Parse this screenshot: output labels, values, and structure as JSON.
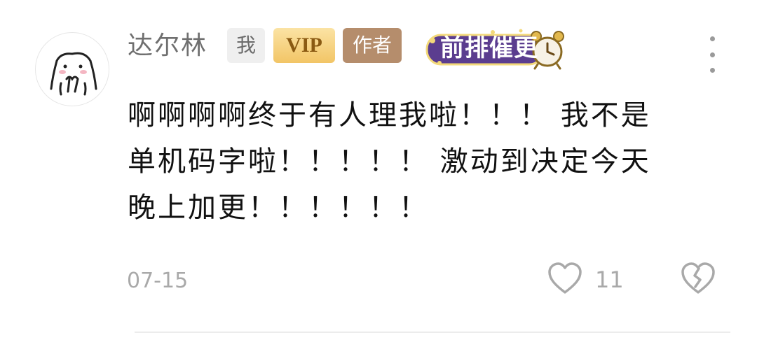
{
  "comment": {
    "username": "达尔林",
    "badges": {
      "me": "我",
      "vip": "VIP",
      "author": "作者"
    },
    "medal": {
      "label": "前排催更",
      "icon": "alarm-clock-icon"
    },
    "content_lines": [
      "啊啊啊啊终于有人理我啦！！！ 我不是",
      "单机码字啦！！！！！ 激动到决定今天",
      "晚上加更！！！！！！"
    ],
    "date": "07-15",
    "like_count": "11",
    "icons": {
      "like": "heart-outline-icon",
      "dislike": "broken-heart-icon",
      "more": "more-vertical-icon"
    }
  },
  "colors": {
    "vip_gold": "#f2c566",
    "author_brown": "#b58d6c",
    "medal_purple": "#5b3d8f",
    "text_gray": "#a9a9a9"
  }
}
